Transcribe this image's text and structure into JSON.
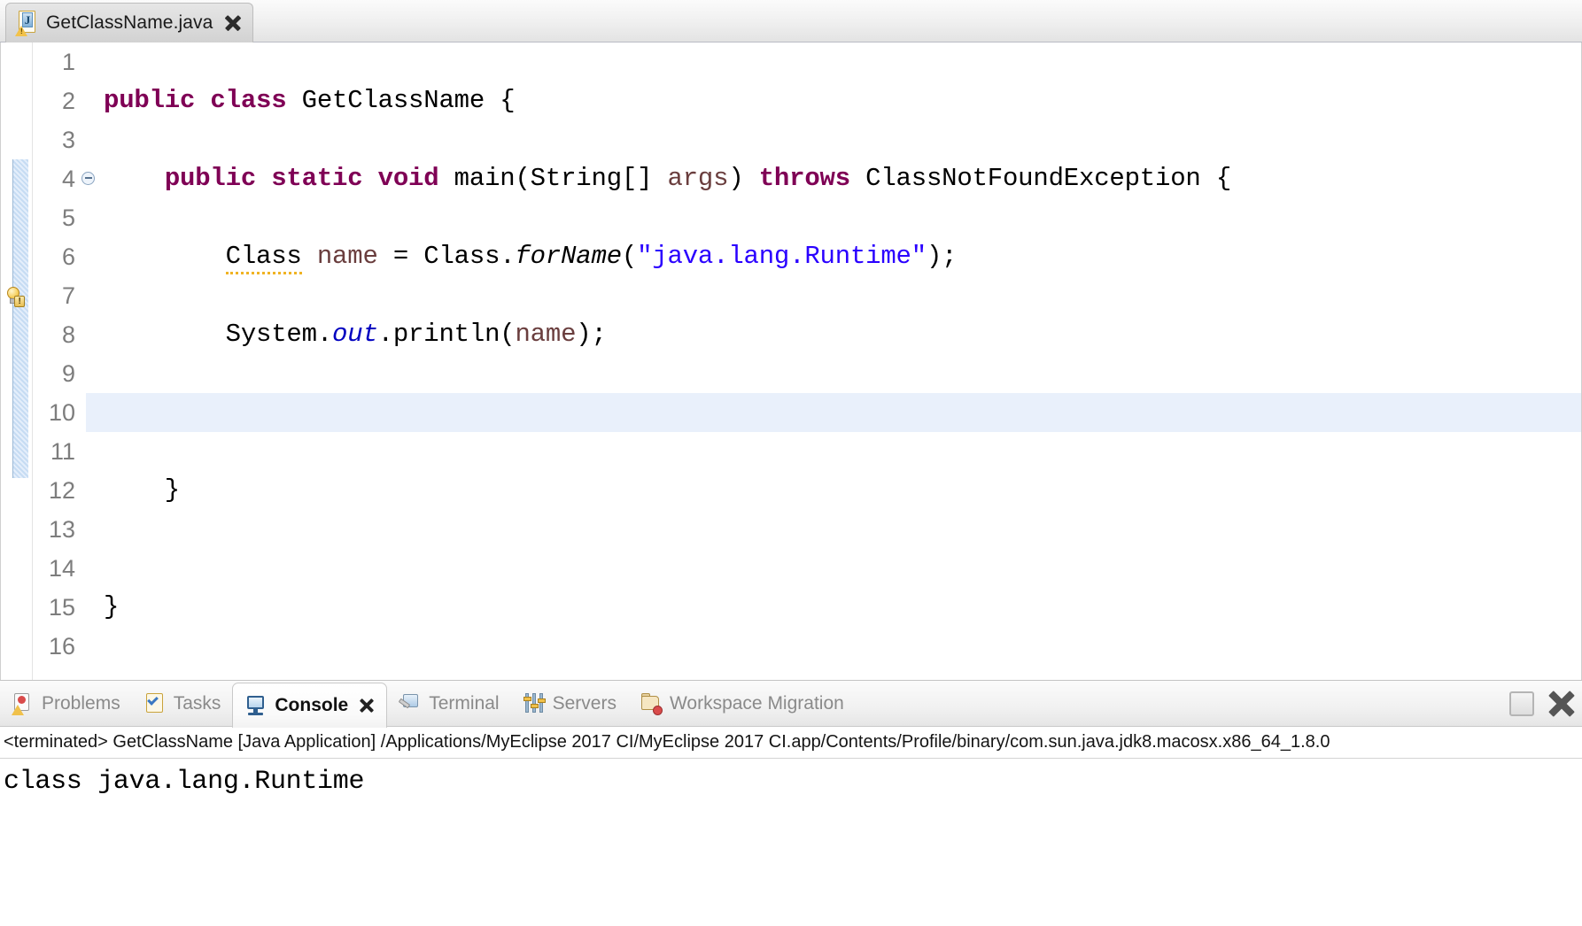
{
  "editor": {
    "tab": {
      "title": "GetClassName.java",
      "icon": "java-file-warning-icon",
      "close_icon": "close-icon"
    },
    "gutter": {
      "warning_bulb_line": 6,
      "fold_line": 4,
      "change_stripe_from_line": 4,
      "change_stripe_to_line": 11
    },
    "active_line": 10,
    "lines": [
      {
        "n": "1",
        "tokens": []
      },
      {
        "n": "2",
        "tokens": [
          {
            "t": "public",
            "c": "kw"
          },
          {
            "t": " ",
            "c": ""
          },
          {
            "t": "class",
            "c": "kw"
          },
          {
            "t": " GetClassName {",
            "c": ""
          }
        ]
      },
      {
        "n": "3",
        "tokens": []
      },
      {
        "n": "4",
        "tokens": [
          {
            "t": "    ",
            "c": ""
          },
          {
            "t": "public",
            "c": "kw"
          },
          {
            "t": " ",
            "c": ""
          },
          {
            "t": "static",
            "c": "kw"
          },
          {
            "t": " ",
            "c": ""
          },
          {
            "t": "void",
            "c": "kw"
          },
          {
            "t": " main(String[] ",
            "c": ""
          },
          {
            "t": "args",
            "c": "parm"
          },
          {
            "t": ") ",
            "c": ""
          },
          {
            "t": "throws",
            "c": "kw"
          },
          {
            "t": " ClassNotFoundException {",
            "c": ""
          }
        ]
      },
      {
        "n": "5",
        "tokens": []
      },
      {
        "n": "6",
        "tokens": [
          {
            "t": "        ",
            "c": ""
          },
          {
            "t": "Class",
            "c": "warnuline"
          },
          {
            "t": " ",
            "c": ""
          },
          {
            "t": "name",
            "c": "local"
          },
          {
            "t": " = Class.",
            "c": ""
          },
          {
            "t": "forName",
            "c": "meth"
          },
          {
            "t": "(",
            "c": ""
          },
          {
            "t": "\"java.lang.Runtime\"",
            "c": "str"
          },
          {
            "t": ");",
            "c": ""
          }
        ]
      },
      {
        "n": "7",
        "tokens": []
      },
      {
        "n": "8",
        "tokens": [
          {
            "t": "        System.",
            "c": ""
          },
          {
            "t": "out",
            "c": "stat"
          },
          {
            "t": ".println(",
            "c": ""
          },
          {
            "t": "name",
            "c": "local"
          },
          {
            "t": ");",
            "c": ""
          }
        ]
      },
      {
        "n": "9",
        "tokens": []
      },
      {
        "n": "10",
        "tokens": []
      },
      {
        "n": "11",
        "tokens": []
      },
      {
        "n": "12",
        "tokens": [
          {
            "t": "    }",
            "c": ""
          }
        ]
      },
      {
        "n": "13",
        "tokens": []
      },
      {
        "n": "14",
        "tokens": []
      },
      {
        "n": "15",
        "tokens": [
          {
            "t": "}",
            "c": ""
          }
        ]
      },
      {
        "n": "16",
        "tokens": []
      }
    ]
  },
  "bottom_panel": {
    "tabs": [
      {
        "label": "Problems",
        "icon": "problems-icon",
        "active": false
      },
      {
        "label": "Tasks",
        "icon": "tasks-icon",
        "active": false
      },
      {
        "label": "Console",
        "icon": "console-icon",
        "active": true
      },
      {
        "label": "Terminal",
        "icon": "terminal-icon",
        "active": false
      },
      {
        "label": "Servers",
        "icon": "servers-icon",
        "active": false
      },
      {
        "label": "Workspace Migration",
        "icon": "workspace-migration-icon",
        "active": false
      }
    ],
    "maximize_label": "maximize-icon",
    "close_label": "close-icon",
    "console": {
      "launch_info": "<terminated> GetClassName [Java Application] /Applications/MyEclipse 2017 CI/MyEclipse 2017 CI.app/Contents/Profile/binary/com.sun.java.jdk8.macosx.x86_64_1.8.0",
      "output": "class java.lang.Runtime"
    }
  },
  "colors": {
    "keyword": "#7f0055",
    "string": "#2a00ff",
    "static_field": "#0000c0",
    "local_var": "#6a3e3e",
    "line_number": "#7d7d7d",
    "active_line_highlight": "#e9f0fb",
    "warning_underline": "#f0b323"
  }
}
